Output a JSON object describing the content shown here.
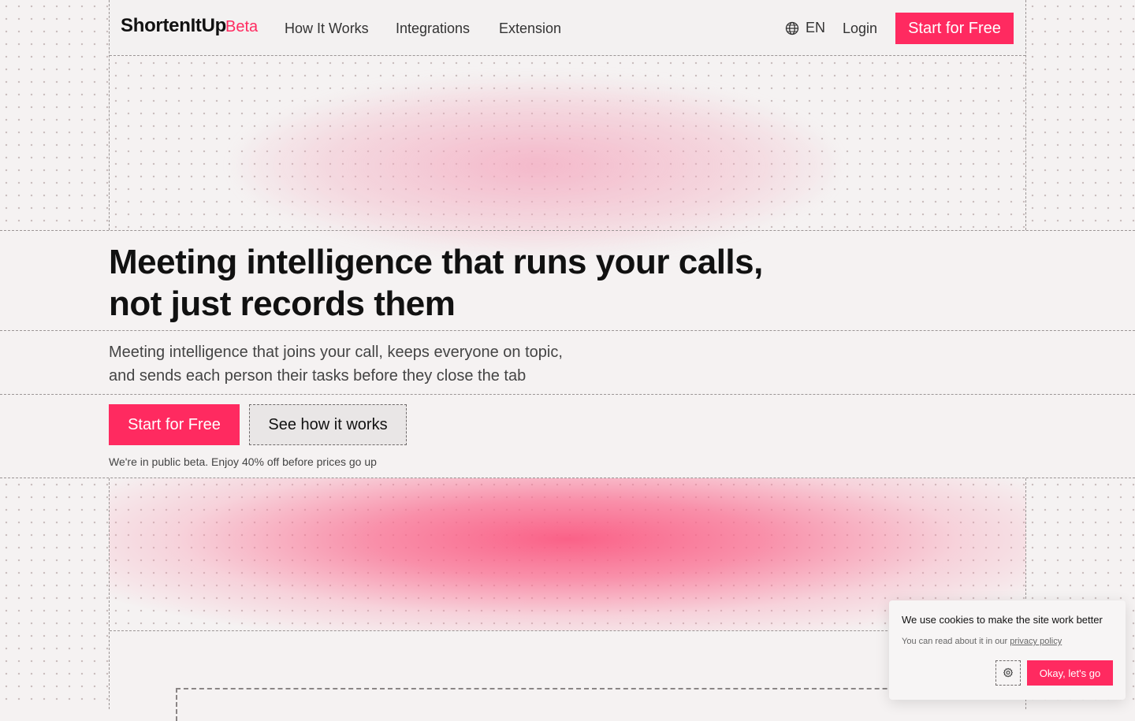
{
  "brand": {
    "name": "ShortenItUp",
    "badge": "Beta",
    "accent_color": "#ff2a60"
  },
  "nav": {
    "items": [
      {
        "label": "How It Works"
      },
      {
        "label": "Integrations"
      },
      {
        "label": "Extension"
      }
    ],
    "language": {
      "icon": "globe-icon",
      "label": "EN"
    },
    "login_label": "Login",
    "cta_label": "Start for Free"
  },
  "hero": {
    "title": "Meeting intelligence that runs your calls, not just records them",
    "subtitle_line1": "Meeting intelligence that joins your call, keeps everyone on topic,",
    "subtitle_line2": "and sends each person their tasks before they close the tab",
    "primary_cta": "Start for Free",
    "secondary_cta": "See how it works",
    "beta_note": "We're in public beta. Enjoy 40% off before prices go up"
  },
  "cookie_banner": {
    "title": "We use cookies to make the site work better",
    "text_prefix": "You can read about it in our ",
    "link_label": "privacy policy",
    "settings_icon": "gear-icon",
    "accept_label": "Okay, let's go"
  }
}
